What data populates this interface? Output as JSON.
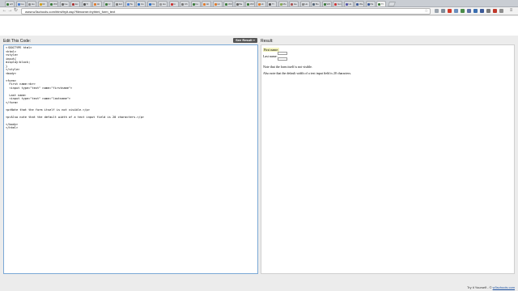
{
  "browser": {
    "url": "www.w3schools.com/html/tryit.asp?filename=tryhtml_form_text",
    "tabs": [
      "w3",
      "Go",
      "Ho",
      "Dr",
      "W3",
      "Ge",
      "Ex",
      "Tr",
      "Ht",
      "Cr",
      "Ed",
      "Ta",
      "Cs",
      "Cs",
      "Ho",
      "In",
      "Ch",
      "Fo",
      "Ht",
      "Ht",
      "W3",
      "Ba",
      "W3",
      "Ht",
      "Tr",
      "Mo",
      "He",
      "Ho",
      "Bo",
      "W3",
      "Gm",
      "Us",
      "We",
      "Pa",
      "Tr"
    ]
  },
  "page": {
    "left_label": "Edit This Code:",
    "see_result_button": "See Result »",
    "right_label": "Result:"
  },
  "code_lines": [
    "<!DOCTYPE html>",
    "<html>",
    "<style>",
    "input{",
    "display:block;",
    "}",
    "</style>",
    "<body>",
    "",
    "<form>",
    "  First name:<br>",
    "  <input type=\"text\" name=\"firstname\">",
    "",
    "  Last name:",
    "  <input type=\"text\" name=\"lastname\">",
    "</form>",
    "",
    "<p>Note that the form itself is not visible.</p>",
    "",
    "<p>Also note that the default width of a text input field is 20 characters.</p>",
    "",
    "</body>",
    "</html>"
  ],
  "result": {
    "first_name_label": "First name:",
    "last_name_label": "Last name:",
    "note1": "Note that the form itself is not visible.",
    "note2": "Also note that the default width of a text input field is 20 characters."
  },
  "footer": {
    "prefix": "Try it Yourself - © ",
    "link": "w3schools.com"
  },
  "colors": {
    "button_bg": "#555555",
    "editor_border": "#7aa8d6",
    "link": "#1a4fa0"
  }
}
